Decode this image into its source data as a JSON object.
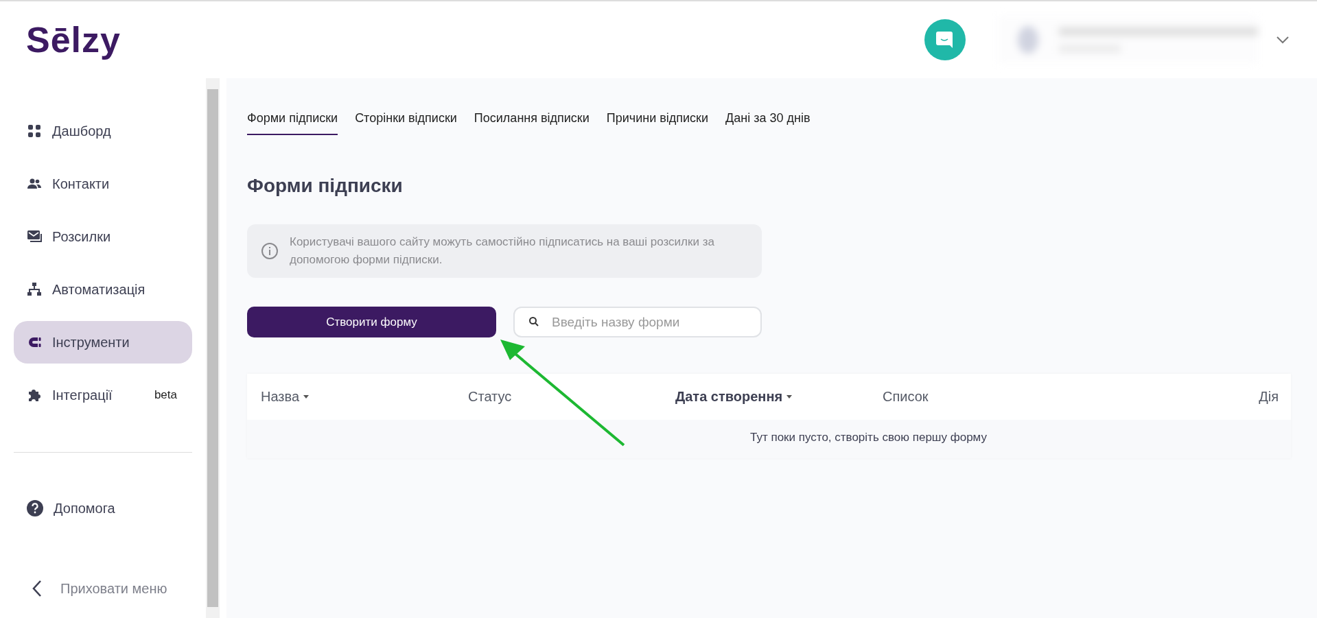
{
  "logo": {
    "text": "Sēlzy"
  },
  "sidebar": {
    "items": [
      {
        "label": "Дашборд",
        "selected": false
      },
      {
        "label": "Контакти",
        "selected": false
      },
      {
        "label": "Розсилки",
        "selected": false
      },
      {
        "label": "Автоматизація",
        "selected": false
      },
      {
        "label": "Інструменти",
        "selected": true
      },
      {
        "label": "Інтеграції",
        "selected": false,
        "badge": "beta"
      }
    ],
    "help": {
      "label": "Допомога"
    },
    "collapse": {
      "label": "Приховати меню"
    }
  },
  "tabs": [
    {
      "label": "Форми підписки",
      "selected": true
    },
    {
      "label": "Сторінки відписки",
      "selected": false
    },
    {
      "label": "Посилання відписки",
      "selected": false
    },
    {
      "label": "Причини відписки",
      "selected": false
    },
    {
      "label": "Дані за 30 днів",
      "selected": false
    }
  ],
  "heading": "Форми підписки",
  "info": "Користувачі вашого сайту можуть самостійно підписатись на ваші розсилки за допомогою форми підписки.",
  "create_button": "Створити форму",
  "search": {
    "placeholder": "Введіть назву форми"
  },
  "table": {
    "columns": [
      {
        "label": "Назва",
        "sortable": true,
        "active": false
      },
      {
        "label": "Статус",
        "sortable": false,
        "active": false
      },
      {
        "label": "Дата створення",
        "sortable": true,
        "active": true
      },
      {
        "label": "Список",
        "sortable": false,
        "active": false
      },
      {
        "label": "Дія",
        "sortable": false,
        "active": false
      }
    ],
    "empty": "Тут поки пусто, створіть свою першу форму"
  }
}
